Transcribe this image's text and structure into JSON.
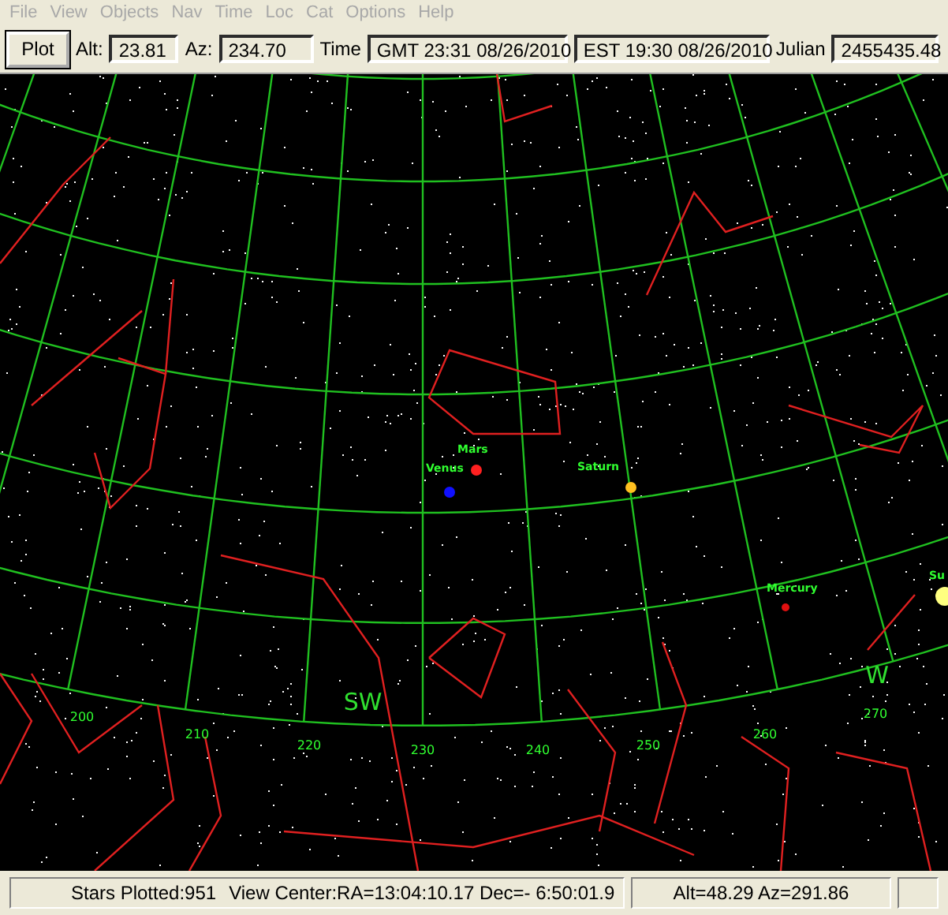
{
  "menu": [
    "File",
    "View",
    "Objects",
    "Nav",
    "Time",
    "Loc",
    "Cat",
    "Options",
    "Help"
  ],
  "toolbar": {
    "plot_button": "Plot",
    "fields": [
      {
        "label": "Alt:",
        "value": "23.81"
      },
      {
        "label": "Az:",
        "value": "234.70"
      },
      {
        "label": "Time",
        "value": "GMT 23:31 08/26/2010"
      },
      {
        "value": "EST 19:30  08/26/2010"
      },
      {
        "label": "Julian",
        "value": "2455435.48"
      }
    ]
  },
  "chart": {
    "azimuth_labels": [
      "200",
      "210",
      "220",
      "230",
      "240",
      "250",
      "260",
      "270"
    ],
    "cardinal_labels": [
      "SW",
      "W"
    ],
    "planets": [
      {
        "name": "Mars",
        "color": "#ff2020"
      },
      {
        "name": "Venus",
        "color": "#1010ff"
      },
      {
        "name": "Saturn",
        "color": "#ffc020"
      },
      {
        "name": "Mercury",
        "color": "#e01010"
      },
      {
        "name": "Su",
        "color": "#ffff80"
      }
    ]
  },
  "status_bar": {
    "left": [
      "Stars Plotted:951",
      "View Center:RA=13:04:10.17 Dec=- 6:50:01.9"
    ],
    "right": "Alt=48.29  Az=291.86"
  }
}
